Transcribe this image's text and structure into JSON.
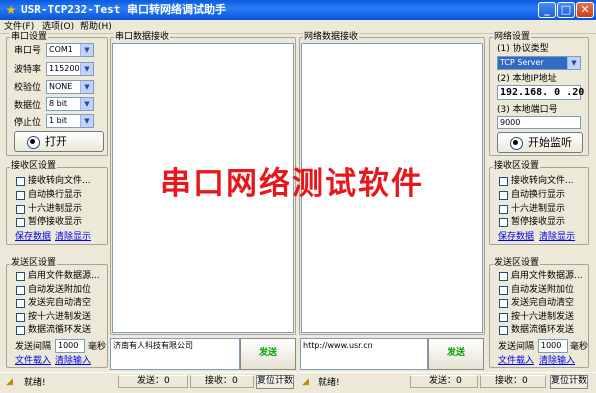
{
  "window": {
    "title": "USR-TCP232-Test  串口转网络调试助手",
    "controls": {
      "minimize": "_",
      "maximize": "□",
      "close": "✕"
    }
  },
  "menu": [
    "文件(F)",
    "选项(O)",
    "帮助(H)"
  ],
  "serial_settings": {
    "title": "串口设置",
    "port_label": "串口号",
    "port_value": "COM1",
    "baud_label": "波特率",
    "baud_value": "115200",
    "parity_label": "校验位",
    "parity_value": "NONE",
    "databits_label": "数据位",
    "databits_value": "8 bit",
    "stopbits_label": "停止位",
    "stopbits_value": "1 bit",
    "open_button": "打开"
  },
  "left_recv_settings": {
    "title": "接收区设置",
    "options": [
      "接收转向文件...",
      "自动换行显示",
      "十六进制显示",
      "暂停接收显示"
    ],
    "save_link": "保存数据",
    "clear_link": "清除显示"
  },
  "left_send_settings": {
    "title": "发送区设置",
    "options": [
      "启用文件数据源...",
      "自动发送附加位",
      "发送完自动清空",
      "按十六进制发送",
      "数据流循环发送"
    ],
    "interval_label": "发送间隔",
    "interval_value": "1000",
    "interval_unit": "毫秒",
    "load_link": "文件载入",
    "clear_link": "清除输入"
  },
  "serial_recv": {
    "title": "串口数据接收"
  },
  "network_recv": {
    "title": "网络数据接收"
  },
  "serial_send": {
    "text": "济南有人科技有限公司",
    "button": "发送"
  },
  "network_send": {
    "text": "http://www.usr.cn",
    "button": "发送"
  },
  "network_settings": {
    "title": "网络设置",
    "protocol_label": "(1) 协议类型",
    "protocol_value": "TCP Server",
    "ip_label": "(2) 本地IP地址",
    "ip_value": "192.168. 0 .20",
    "port_label": "(3) 本地端口号",
    "port_value": "9000",
    "listen_button": "开始监听"
  },
  "right_recv_settings": {
    "title": "接收区设置",
    "options": [
      "接收转向文件...",
      "自动换行显示",
      "十六进制显示",
      "暂停接收显示"
    ],
    "save_link": "保存数据",
    "clear_link": "清除显示"
  },
  "right_send_settings": {
    "title": "发送区设置",
    "options": [
      "启用文件数据源...",
      "自动发送附加位",
      "发送完自动清空",
      "按十六进制发送",
      "数据流循环发送"
    ],
    "interval_label": "发送间隔",
    "interval_value": "1000",
    "interval_unit": "毫秒",
    "load_link": "文件载入",
    "clear_link": "清除输入"
  },
  "status_left": {
    "status": "就绪!",
    "sent": "发送：0",
    "recv": "接收：0",
    "reset": "复位计数"
  },
  "status_right": {
    "status": "就绪!",
    "sent": "发送：0",
    "recv": "接收：0",
    "reset": "复位计数"
  },
  "overlay_text": "串口网络测试软件"
}
